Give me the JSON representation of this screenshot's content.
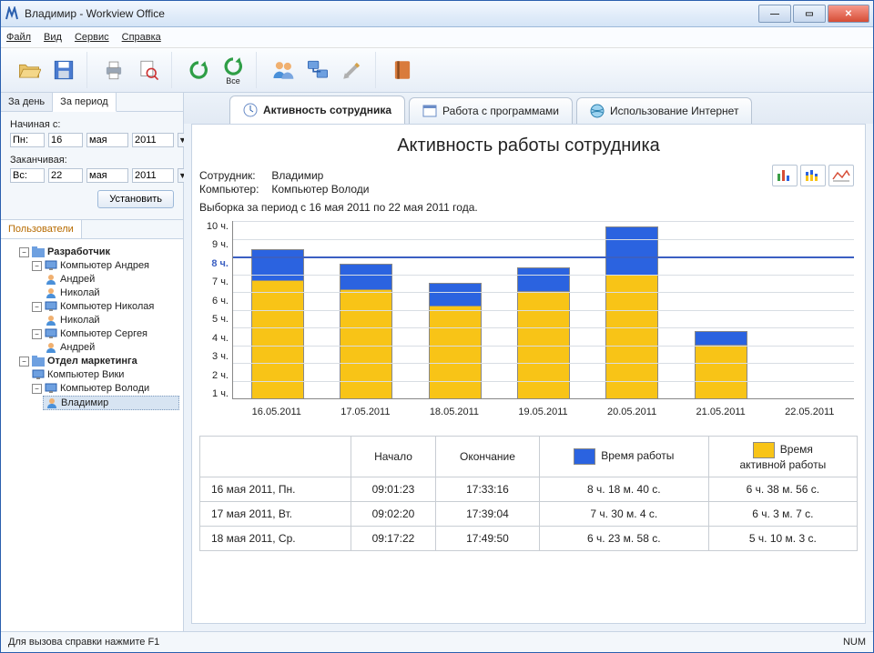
{
  "title": "Владимир - Workview Office",
  "menu": {
    "file": "Файл",
    "view": "Вид",
    "service": "Сервис",
    "help": "Справка"
  },
  "toolbar": {
    "all_label": "Все"
  },
  "side_tabs": {
    "day": "За день",
    "period": "За период"
  },
  "filter": {
    "from_label": "Начиная с:",
    "from_dow": "Пн:",
    "from_day": "16",
    "from_month": "мая",
    "from_year": "2011",
    "to_label": "Заканчивая:",
    "to_dow": "Вс:",
    "to_day": "22",
    "to_month": "мая",
    "to_year": "2011",
    "apply": "Установить"
  },
  "users_tab": "Пользователи",
  "tree": {
    "dev": "Разработчик",
    "pc_andrey": "Компьютер Андрея",
    "u_andrey": "Андрей",
    "u_nikolay": "Николай",
    "pc_nikolay": "Компьютер Николая",
    "u_nikolay2": "Николай",
    "pc_sergey": "Компьютер Сергея",
    "u_andrey2": "Андрей",
    "marketing": "Отдел маркетинга",
    "pc_viki": "Компьютер Вики",
    "pc_volodi": "Компьютер Володи",
    "u_vladimir": "Владимир"
  },
  "tabs": {
    "activity": "Активность сотрудника",
    "programs": "Работа с программами",
    "internet": "Использование Интернет"
  },
  "report": {
    "title": "Активность работы сотрудника",
    "emp_label": "Сотрудник:",
    "emp_value": "Владимир",
    "pc_label": "Компьютер:",
    "pc_value": "Компьютер Володи",
    "range": "Выборка за период с 16 мая 2011 по 22 мая 2011 года."
  },
  "chart_data": {
    "type": "bar",
    "categories": [
      "16.05.2011",
      "17.05.2011",
      "18.05.2011",
      "19.05.2011",
      "20.05.2011",
      "21.05.2011",
      "22.05.2011"
    ],
    "series": [
      {
        "name": "Время работы",
        "values": [
          8.3,
          7.5,
          6.4,
          7.3,
          9.6,
          3.7,
          0
        ]
      },
      {
        "name": "Время активной работы",
        "values": [
          6.6,
          6.1,
          5.2,
          6.0,
          6.9,
          3.0,
          0
        ]
      }
    ],
    "reference_line": 8,
    "ylabel_suffix": " ч.",
    "ylim": [
      0,
      10
    ],
    "yticks": [
      1,
      2,
      3,
      4,
      5,
      6,
      7,
      8,
      9,
      10
    ]
  },
  "table": {
    "col_date": "",
    "col_start": "Начало",
    "col_end": "Окончание",
    "col_work": "Время работы",
    "col_active": "Время\nактивной работы",
    "rows": [
      {
        "d": "16 мая 2011, Пн.",
        "s": "09:01:23",
        "e": "17:33:16",
        "w": "8 ч. 18 м. 40 с.",
        "a": "6 ч. 38 м. 56 с."
      },
      {
        "d": "17 мая 2011, Вт.",
        "s": "09:02:20",
        "e": "17:39:04",
        "w": "7 ч. 30 м. 4 с.",
        "a": "6 ч. 3 м. 7 с."
      },
      {
        "d": "18 мая 2011, Ср.",
        "s": "09:17:22",
        "e": "17:49:50",
        "w": "6 ч. 23 м. 58 с.",
        "a": "5 ч. 10 м. 3 с."
      }
    ]
  },
  "status": {
    "hint": "Для вызова справки нажмите F1",
    "num": "NUM"
  }
}
